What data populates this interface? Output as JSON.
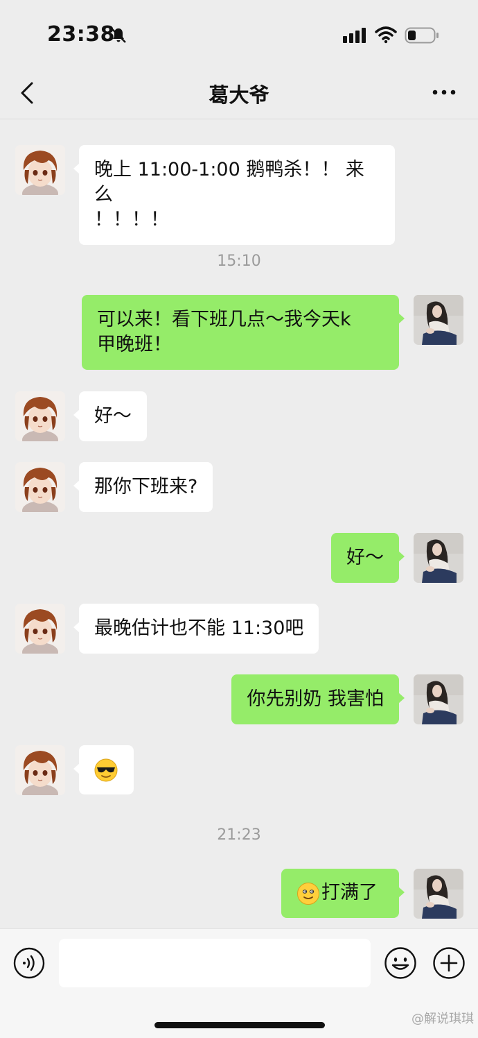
{
  "status_bar": {
    "time": "23:38"
  },
  "chat": {
    "title": "葛大爷"
  },
  "messages": [
    {
      "text": "晚上 11:00-1:00 鹅鸭杀！！ 来么\n！！！！"
    },
    {
      "timestamp": "15:10"
    },
    {
      "text": "可以来！看下班几点～我今天k\n甲晚班！"
    },
    {
      "text": "好～"
    },
    {
      "text": "那你下班来?"
    },
    {
      "text": "好～"
    },
    {
      "text": "最晚估计也不能 11:30吧"
    },
    {
      "text": "你先别奶 我害怕"
    },
    {
      "emoji": "cool-sunglasses-emoji"
    },
    {
      "timestamp": "21:23"
    },
    {
      "text": "打满了",
      "emoji": "smile-emoji"
    }
  ],
  "watermark": "@解说琪琪",
  "colors": {
    "background": "#EDEDED",
    "incoming_bubble": "#FFFFFF",
    "outgoing_bubble": "#95EC69"
  }
}
